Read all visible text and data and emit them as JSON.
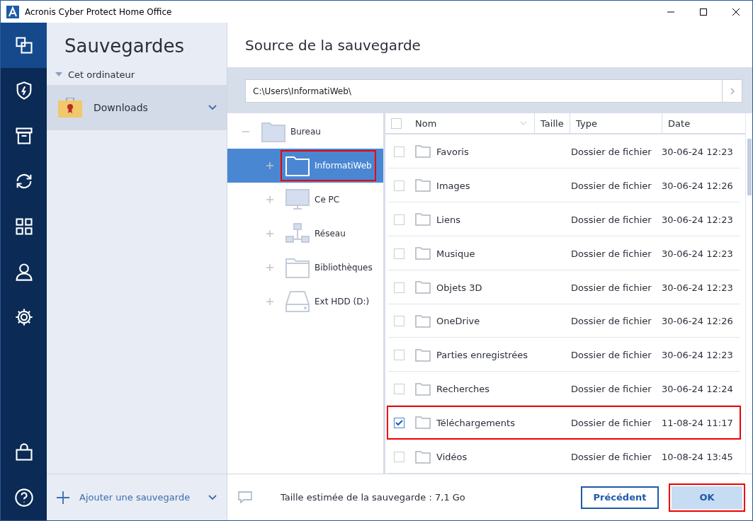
{
  "window": {
    "title": "Acronis Cyber Protect Home Office"
  },
  "nav": [
    {
      "selected": true
    },
    {
      "selected": false
    },
    {
      "selected": false
    },
    {
      "selected": false
    },
    {
      "selected": false
    },
    {
      "selected": false
    },
    {
      "selected": false
    }
  ],
  "sidebar": {
    "title": "Sauvegardes",
    "group": "Cet ordinateur",
    "items": [
      {
        "label": "Downloads",
        "selected": true
      }
    ],
    "add_label": "Ajouter une sauvegarde"
  },
  "main": {
    "title": "Source de la sauvegarde",
    "path": "C:\\Users\\InformatiWeb\\"
  },
  "tree": [
    {
      "label": "Bureau",
      "kind": "folder",
      "expanded": true,
      "selected": false,
      "highlighted": false,
      "children": [
        {
          "label": "InformatiWeb",
          "kind": "folder",
          "expanded": false,
          "selected": true,
          "highlighted": true
        },
        {
          "label": "Ce PC",
          "kind": "pc",
          "expanded": false,
          "selected": false,
          "highlighted": false
        },
        {
          "label": "Réseau",
          "kind": "network",
          "expanded": false,
          "selected": false,
          "highlighted": false
        },
        {
          "label": "Bibliothèques",
          "kind": "library",
          "expanded": false,
          "selected": false,
          "highlighted": false
        },
        {
          "label": "Ext HDD (D:)",
          "kind": "drive",
          "expanded": false,
          "selected": false,
          "highlighted": false
        }
      ]
    }
  ],
  "table": {
    "all_checked": false,
    "columns": [
      "Nom",
      "Taille",
      "Type",
      "Date"
    ],
    "rows": [
      {
        "name": "Favoris",
        "type": "Dossier de fichier",
        "date": "30-06-24 12:23",
        "checked": false,
        "highlighted": false
      },
      {
        "name": "Images",
        "type": "Dossier de fichier",
        "date": "30-06-24 12:26",
        "checked": false,
        "highlighted": false
      },
      {
        "name": "Liens",
        "type": "Dossier de fichier",
        "date": "30-06-24 12:23",
        "checked": false,
        "highlighted": false
      },
      {
        "name": "Musique",
        "type": "Dossier de fichier",
        "date": "30-06-24 12:23",
        "checked": false,
        "highlighted": false
      },
      {
        "name": "Objets 3D",
        "type": "Dossier de fichier",
        "date": "30-06-24 12:23",
        "checked": false,
        "highlighted": false
      },
      {
        "name": "OneDrive",
        "type": "Dossier de fichier",
        "date": "30-06-24 12:26",
        "checked": false,
        "highlighted": false
      },
      {
        "name": "Parties enregistrées",
        "type": "Dossier de fichier",
        "date": "30-06-24 12:23",
        "checked": false,
        "highlighted": false
      },
      {
        "name": "Recherches",
        "type": "Dossier de fichier",
        "date": "30-06-24 12:24",
        "checked": false,
        "highlighted": false
      },
      {
        "name": "Téléchargements",
        "type": "Dossier de fichier",
        "date": "11-08-24 11:17",
        "checked": true,
        "highlighted": true
      },
      {
        "name": "Vidéos",
        "type": "Dossier de fichier",
        "date": "10-08-24 13:45",
        "checked": false,
        "highlighted": false
      }
    ]
  },
  "footer": {
    "estimate": "Taille estimée de la sauvegarde : 7,1 Go",
    "back": "Précédent",
    "ok": "OK",
    "ok_highlighted": true
  }
}
